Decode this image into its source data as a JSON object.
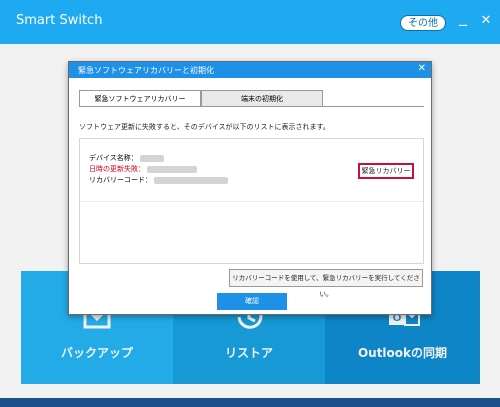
{
  "app": {
    "title": "Smart Switch",
    "more_button": "その他",
    "minimize": "_",
    "close": "✕"
  },
  "tiles": [
    {
      "label": "バックアップ",
      "icon": "backup-icon"
    },
    {
      "label": "リストア",
      "icon": "restore-icon"
    },
    {
      "label": "Outlookの同期",
      "icon": "outlook-icon"
    }
  ],
  "dialog": {
    "title": "緊急ソフトウェアリカバリーと初期化",
    "close": "✕",
    "tabs": [
      "緊急ソフトウェアリカバリー",
      "端末の初期化"
    ],
    "description": "ソフトウェア更新に失敗すると、そのデバイスが以下のリストに表示されます。",
    "device": {
      "name_label": "デバイス名称：",
      "failed_label": "日時の更新失敗：",
      "code_label": "リカバリーコード："
    },
    "emergency_button": "緊急リカバリー",
    "use_code_button": "リカバリーコードを使用して、緊急リカバリーを実行してください。",
    "confirm_button": "確認"
  },
  "colors": {
    "accent": "#1eaaf1",
    "dialog_title": "#1e90e6",
    "failed_text": "#d0021b",
    "emergency_border": "#c7103b"
  }
}
